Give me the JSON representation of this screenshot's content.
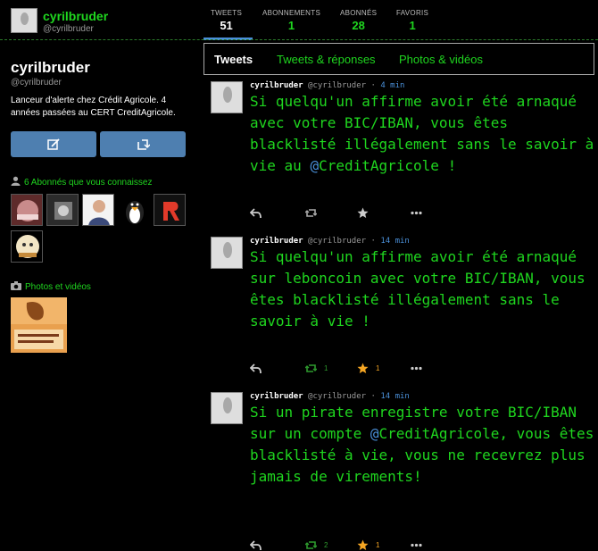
{
  "header": {
    "name": "cyrilbruder",
    "handle": "@cyrilbruder",
    "stats": [
      {
        "label": "TWEETS",
        "value": "51"
      },
      {
        "label": "ABONNEMENTS",
        "value": "1"
      },
      {
        "label": "ABONNÉS",
        "value": "28"
      },
      {
        "label": "FAVORIS",
        "value": "1"
      }
    ]
  },
  "profile": {
    "name": "cyrilbruder",
    "handle": "@cyrilbruder",
    "bio": "Lanceur d'alerte chez Crédit Agricole. 4 années passées au CERT CreditAgricole.",
    "followers_you_know": "6 Abonnés que vous connaissez",
    "photos_title": "Photos et vidéos"
  },
  "tabs": [
    "Tweets",
    "Tweets & réponses",
    "Photos & vidéos"
  ],
  "tweets": [
    {
      "name": "cyrilbruder",
      "handle": "@cyrilbruder",
      "time": "4 min",
      "text_before": "Si quelqu'un affirme avoir été arnaqué avec votre BIC/IBAN, vous êtes blacklisté illégalement sans le savoir à vie au ",
      "mention": "@",
      "mention_word": "CreditAgricole",
      "text_after": " !",
      "retweets": "",
      "favorites": ""
    },
    {
      "name": "cyrilbruder",
      "handle": "@cyrilbruder",
      "time": "14 min",
      "text": "Si quelqu'un affirme avoir été arnaqué sur leboncoin avec votre BIC/IBAN, vous êtes blacklisté illégalement sans le savoir à vie !",
      "retweets": "1",
      "favorites": "1"
    },
    {
      "name": "cyrilbruder",
      "handle": "@cyrilbruder",
      "time": "14 min",
      "text_before": "Si un pirate enregistre votre BIC/IBAN sur un compte ",
      "mention": "@",
      "mention_word": "CreditAgricole",
      "text_after": ", vous êtes blacklisté à vie, vous ne recevrez plus jamais de virements!",
      "retweets": "2",
      "favorites": "1"
    }
  ],
  "colors": {
    "accent_green": "#1fd61f",
    "link_blue": "#4a90d9",
    "button_blue": "#4e7fb0",
    "favorite_orange": "#f5a623"
  }
}
